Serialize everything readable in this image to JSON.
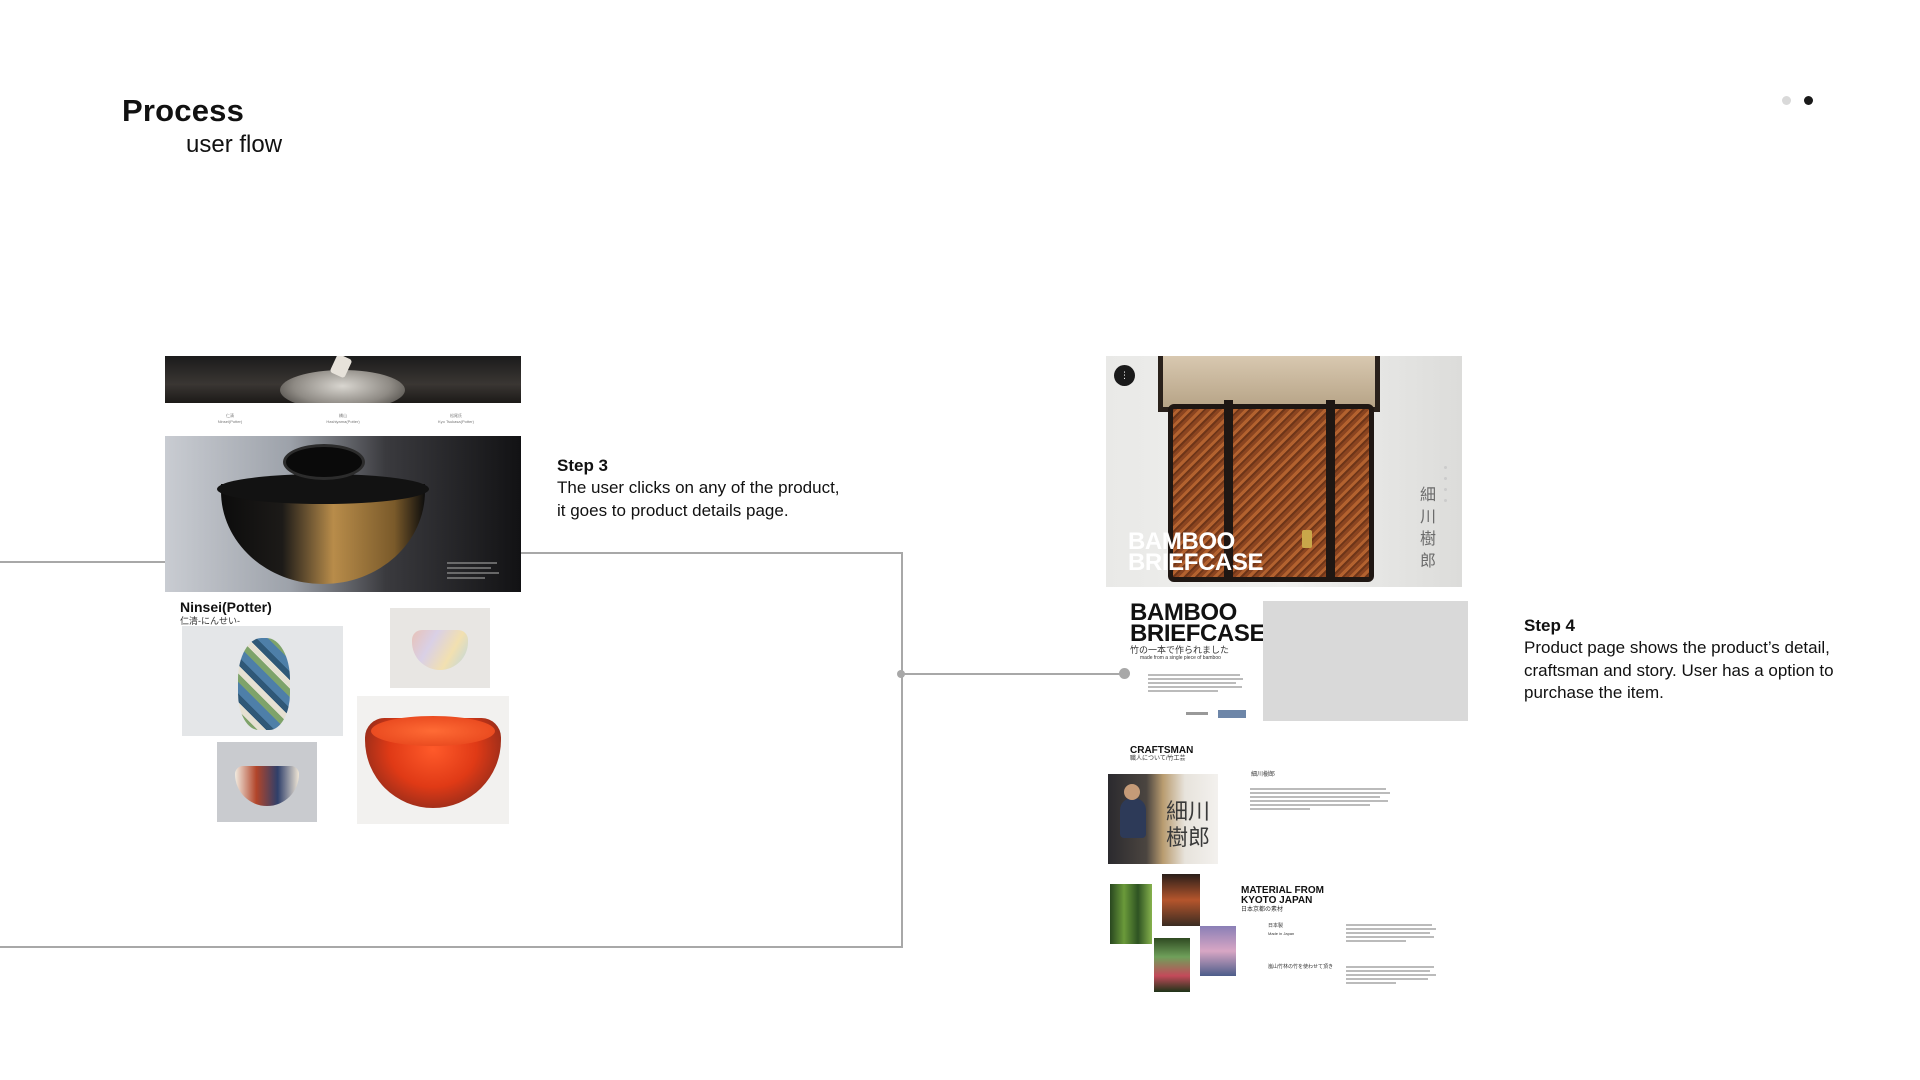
{
  "header": {
    "title": "Process",
    "subtitle": "user flow"
  },
  "pagination": {
    "active_index": 1,
    "colors": {
      "inactive": "#d9d9d9",
      "active": "#1a1a1a"
    }
  },
  "step3": {
    "title": "Step 3",
    "line1": "The user clicks on any of the product,",
    "line2": "it goes to product details page."
  },
  "step4": {
    "title": "Step 4",
    "line1": "Product page shows the product’s detail,",
    "line2": "craftsman and story. User has a option to",
    "line3": "purchase the item."
  },
  "left_mock": {
    "nav": [
      {
        "jp": "仁清",
        "en": "Ninsei(Potter)"
      },
      {
        "jp": "橋山",
        "en": "Hashiyama(Potter)"
      },
      {
        "jp": "松尾氏",
        "en": "Kyo Tsukasa(Potter)"
      }
    ],
    "artist_name": "Ninsei(Potter)",
    "artist_jp": "仁清-にんせい-"
  },
  "right_mock": {
    "hero_title_1": "BAMBOO",
    "hero_title_2": "BRIEFCASE",
    "hero_vertical_jp": "細川樹郎",
    "product_title_1": "BAMBOO",
    "product_title_2": "BRIEFCASE",
    "product_jp": "竹の一本で作られました",
    "product_en": "made from a single piece of bamboo",
    "craftsman_head": "CRAFTSMAN",
    "craftsman_jp": "職人について/竹工芸",
    "craftsman_name_jp": "細川樹郎",
    "craftsman_vertical_jp": "細川樹郎",
    "material_head_1": "MATERIAL FROM",
    "material_head_2": "KYOTO JAPAN",
    "material_jp": "日本京都の素材",
    "made_jp": "日本製",
    "made_en": "Made in Japan",
    "place_jp": "嵐山竹林の竹を使わせて頂き"
  }
}
